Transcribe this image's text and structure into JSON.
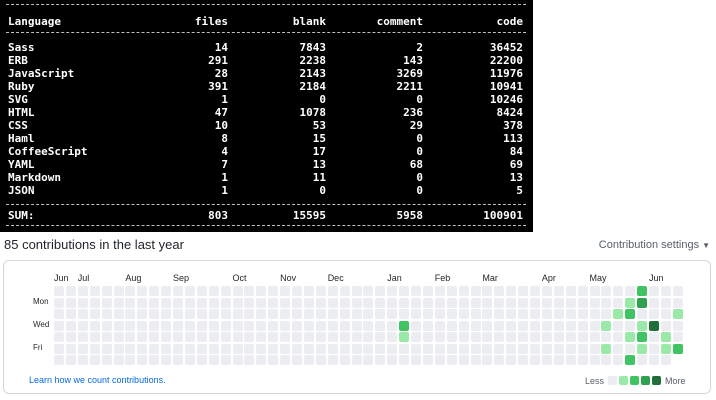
{
  "terminal": {
    "headers": [
      "Language",
      "files",
      "blank",
      "comment",
      "code"
    ],
    "rows": [
      [
        "Sass",
        "14",
        "7843",
        "2",
        "36452"
      ],
      [
        "ERB",
        "291",
        "2238",
        "143",
        "22200"
      ],
      [
        "JavaScript",
        "28",
        "2143",
        "3269",
        "11976"
      ],
      [
        "Ruby",
        "391",
        "2184",
        "2211",
        "10941"
      ],
      [
        "SVG",
        "1",
        "0",
        "0",
        "10246"
      ],
      [
        "HTML",
        "47",
        "1078",
        "236",
        "8424"
      ],
      [
        "CSS",
        "10",
        "53",
        "29",
        "378"
      ],
      [
        "Haml",
        "8",
        "15",
        "0",
        "113"
      ],
      [
        "CoffeeScript",
        "4",
        "17",
        "0",
        "84"
      ],
      [
        "YAML",
        "7",
        "13",
        "68",
        "69"
      ],
      [
        "Markdown",
        "1",
        "11",
        "0",
        "13"
      ],
      [
        "JSON",
        "1",
        "0",
        "0",
        "5"
      ]
    ],
    "sum": [
      "SUM:",
      "803",
      "15595",
      "5958",
      "100901"
    ]
  },
  "contributions": {
    "title": "85 contributions in the last year",
    "settings_label": "Contribution settings",
    "months": [
      "Jun",
      "Jul",
      "Aug",
      "Sep",
      "Oct",
      "Nov",
      "Dec",
      "Jan",
      "Feb",
      "Mar",
      "Apr",
      "May",
      "Jun"
    ],
    "month_week_index": [
      0,
      2,
      6,
      10,
      15,
      19,
      23,
      28,
      32,
      36,
      41,
      45,
      50
    ],
    "days": [
      "Mon",
      "Wed",
      "Fri"
    ],
    "learn_link": "Learn how we count contributions.",
    "legend_less": "Less",
    "legend_more": "More",
    "colors": [
      "#ebedf0",
      "#9be9a8",
      "#40c463",
      "#30a14e",
      "#216e39"
    ],
    "weeks": 53,
    "active_cells": [
      {
        "week": 29,
        "day": 3,
        "level": 2
      },
      {
        "week": 29,
        "day": 4,
        "level": 1
      },
      {
        "week": 46,
        "day": 3,
        "level": 1
      },
      {
        "week": 46,
        "day": 5,
        "level": 1
      },
      {
        "week": 47,
        "day": 2,
        "level": 1
      },
      {
        "week": 48,
        "day": 1,
        "level": 1
      },
      {
        "week": 48,
        "day": 2,
        "level": 2
      },
      {
        "week": 48,
        "day": 4,
        "level": 1
      },
      {
        "week": 48,
        "day": 6,
        "level": 2
      },
      {
        "week": 49,
        "day": 0,
        "level": 2
      },
      {
        "week": 49,
        "day": 1,
        "level": 3
      },
      {
        "week": 49,
        "day": 3,
        "level": 1
      },
      {
        "week": 49,
        "day": 4,
        "level": 2
      },
      {
        "week": 49,
        "day": 5,
        "level": 1
      },
      {
        "week": 50,
        "day": 3,
        "level": 4
      },
      {
        "week": 51,
        "day": 4,
        "level": 1
      },
      {
        "week": 51,
        "day": 5,
        "level": 1
      },
      {
        "week": 52,
        "day": 2,
        "level": 1
      },
      {
        "week": 52,
        "day": 5,
        "level": 2
      }
    ]
  }
}
